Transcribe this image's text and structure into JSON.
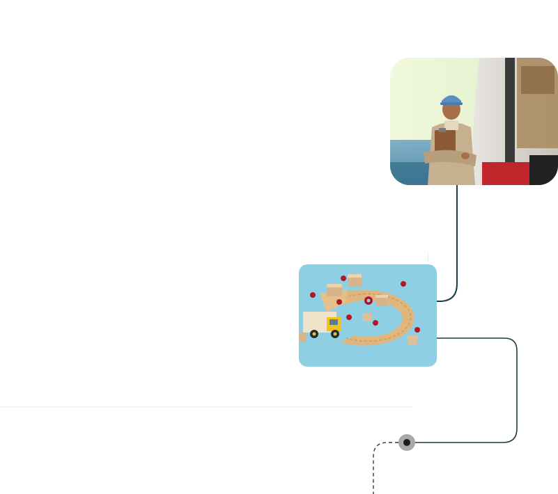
{
  "images": {
    "courier": {
      "alt": ""
    },
    "logistics": {
      "alt": ""
    }
  },
  "colors": {
    "connector": "#1f3b47",
    "node_ring": "#a8a8a8",
    "node_center": "#1b1b1b",
    "divider": "#f2f2f2",
    "logistics_bg": "#8fcfe4",
    "courier_bg": "#e9f4d6"
  }
}
